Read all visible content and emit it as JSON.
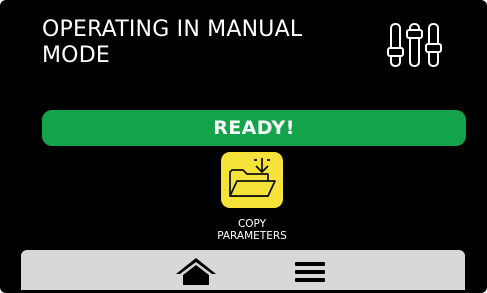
{
  "header": {
    "title": "OPERATING IN MANUAL\nMODE",
    "settings_icon": "sliders-icon"
  },
  "status": {
    "label": "READY!",
    "color": "#13a34a"
  },
  "actions": [
    {
      "icon": "folder-download-icon",
      "label": "COPY\nPARAMETERS",
      "tile_color": "#f6e33a"
    }
  ],
  "bottom_nav": {
    "home_icon": "home-icon",
    "menu_icon": "hamburger-menu-icon",
    "background": "#d8d8d8"
  }
}
